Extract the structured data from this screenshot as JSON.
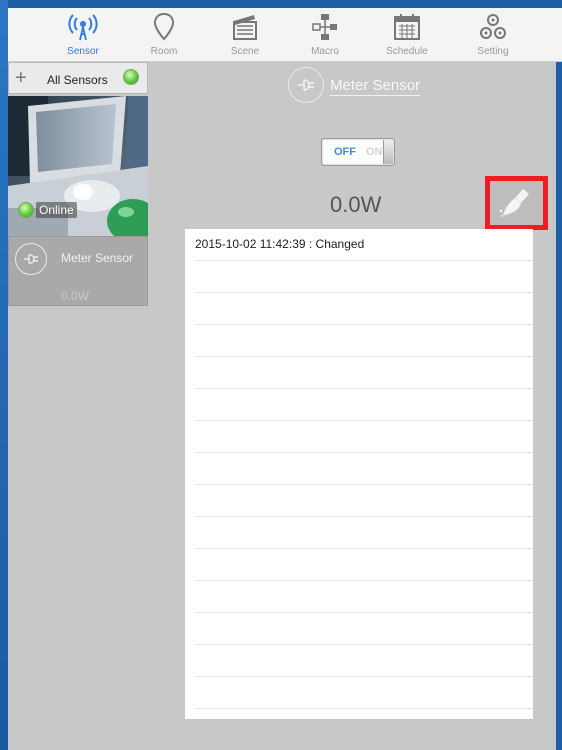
{
  "tabs": [
    {
      "label": "Sensor",
      "icon": "sensor-icon",
      "active": true
    },
    {
      "label": "Room",
      "icon": "location-pin-icon",
      "active": false
    },
    {
      "label": "Scene",
      "icon": "clapperboard-icon",
      "active": false
    },
    {
      "label": "Macro",
      "icon": "macro-flow-icon",
      "active": false
    },
    {
      "label": "Schedule",
      "icon": "calendar-icon",
      "active": false
    },
    {
      "label": "Setting",
      "icon": "gears-icon",
      "active": false
    }
  ],
  "sidebar": {
    "all_sensors_label": "All Sensors",
    "camera_status": "Online",
    "sensor_card": {
      "name": "Meter Sensor",
      "watt": "0.0W"
    }
  },
  "detail": {
    "title": "Meter Sensor",
    "toggle": {
      "off_label": "OFF",
      "on_label": "ON",
      "state": "OFF"
    },
    "watt": "0.0W"
  },
  "log": {
    "entries": [
      "2015-10-02 11:42:39 : Changed"
    ],
    "empty_rows": 14
  },
  "colors": {
    "accent": "#2f7de0",
    "background": "#1d5fa6",
    "panel": "#c8c8c8",
    "highlight": "#ee1c25",
    "status_online": "#5fc83a"
  }
}
